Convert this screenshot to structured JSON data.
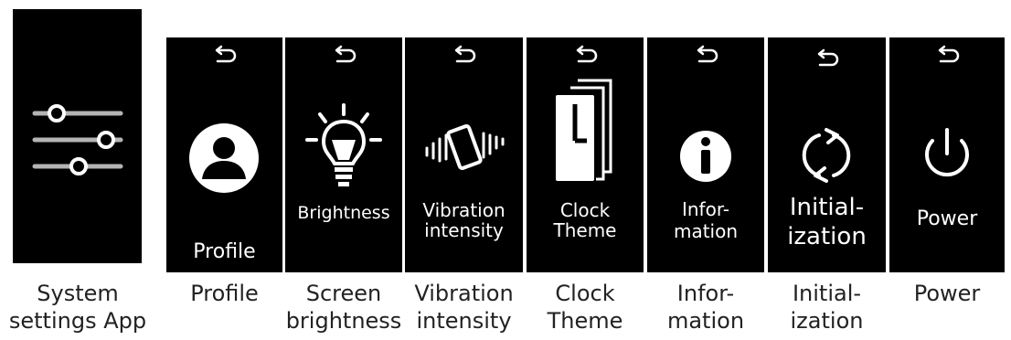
{
  "app_panel": {
    "icon": "sliders-icon"
  },
  "back_icon": "undo-arrow-icon",
  "screens": [
    {
      "name": "profile",
      "icon": "person-icon",
      "label_lines": [
        "Profile"
      ]
    },
    {
      "name": "brightness",
      "icon": "lightbulb-icon",
      "label_lines": [
        "Brightness"
      ]
    },
    {
      "name": "vibration",
      "icon": "vibrating-phone-icon",
      "label_lines": [
        "Vibration",
        "intensity"
      ]
    },
    {
      "name": "clock-theme",
      "icon": "clock-cards-icon",
      "label_lines": [
        "Clock",
        "Theme"
      ]
    },
    {
      "name": "information",
      "icon": "info-icon",
      "label_lines": [
        "Infor-",
        "mation"
      ]
    },
    {
      "name": "initialization",
      "icon": "refresh-icon",
      "label_lines": [
        "Initial-",
        "ization"
      ]
    },
    {
      "name": "power",
      "icon": "power-icon",
      "label_lines": [
        "Power"
      ]
    }
  ],
  "captions": [
    [
      "System",
      "settings App"
    ],
    [
      "Profile"
    ],
    [
      "Screen",
      "brightness"
    ],
    [
      "Vibration",
      "intensity"
    ],
    [
      "Clock",
      "Theme"
    ],
    [
      "Infor-",
      "mation"
    ],
    [
      "Initial-",
      "ization"
    ],
    [
      "Power"
    ]
  ],
  "colors": {
    "screen_bg": "#000000",
    "foreground": "#ffffff",
    "slider_track": "#b4b4b4",
    "caption_text": "#222222"
  }
}
